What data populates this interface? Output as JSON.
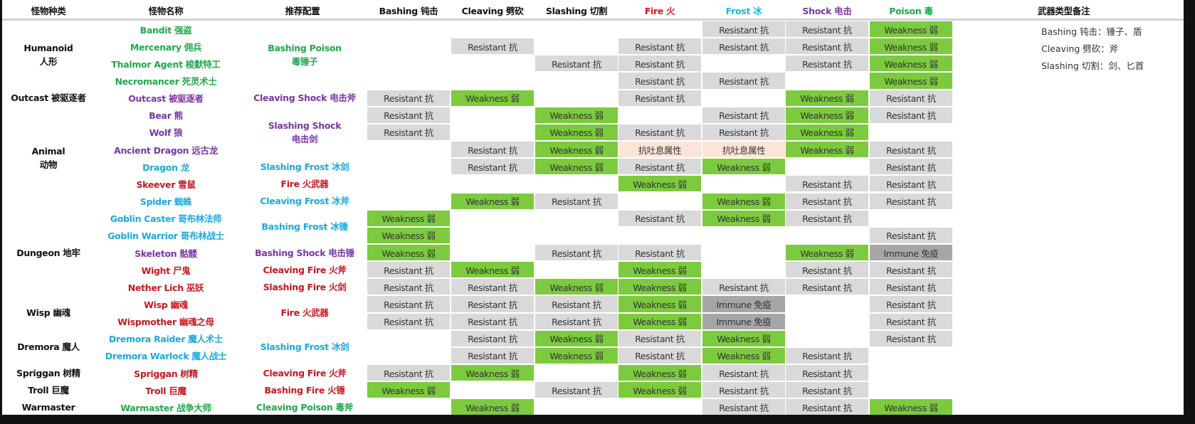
{
  "headers": {
    "type": "怪物种类",
    "name": "怪物名称",
    "config": "推荐配置",
    "damage": [
      {
        "label": "Bashing 钝击",
        "color": "#111111"
      },
      {
        "label": "Cleaving 劈砍",
        "color": "#111111"
      },
      {
        "label": "Slashing 切割",
        "color": "#111111"
      },
      {
        "label": "Fire 火",
        "color": "#e0141e"
      },
      {
        "label": "Frost 冰",
        "color": "#1eb4e6"
      },
      {
        "label": "Shock 电击",
        "color": "#7a35a8"
      },
      {
        "label": "Poison 毒",
        "color": "#1aab4b"
      }
    ],
    "notes": "武器类型备注"
  },
  "notes": [
    "Bashing 钝击：锤子、盾",
    "Cleaving 劈砍：斧",
    "Slashing 切割：剑、匕首"
  ],
  "colors": {
    "green": "#1fa84c",
    "purple": "#7a35a8",
    "cyan": "#1aa9e0",
    "red": "#c8161e"
  },
  "cell_colors": {
    "Resistant 抗": "#d9d9d9",
    "Weakness 弱": "#7ccb3e",
    "Immune 免疫": "#a6a6a6",
    "抗吐息属性": "#fce4d6"
  },
  "groups": [
    {
      "lines": [
        "Humanoid",
        "人形"
      ],
      "start": 0,
      "span": 4
    },
    {
      "lines": [
        "Outcast 被驱逐者"
      ],
      "start": 4,
      "span": 1
    },
    {
      "lines": [
        "Animal",
        "动物"
      ],
      "start": 5,
      "span": 6
    },
    {
      "lines": [
        "Dungeon 地牢"
      ],
      "start": 11,
      "span": 5
    },
    {
      "lines": [
        "Wisp 幽魂"
      ],
      "start": 16,
      "span": 2
    },
    {
      "lines": [
        "Dremora 魔人"
      ],
      "start": 18,
      "span": 2
    },
    {
      "lines": [
        "Spriggan 树精"
      ],
      "start": 20,
      "span": 1
    },
    {
      "lines": [
        "Troll 巨魔"
      ],
      "start": 21,
      "span": 1
    },
    {
      "lines": [
        "Warmaster"
      ],
      "start": 22,
      "span": 1
    }
  ],
  "configs": [
    {
      "lines": [
        "Bashing Poison",
        "毒锤子"
      ],
      "color": "green",
      "start": 0,
      "span": 4
    },
    {
      "lines": [
        "Cleaving Shock 电击斧"
      ],
      "color": "purple",
      "start": 4,
      "span": 1
    },
    {
      "lines": [
        "Slashing Shock",
        "电击剑"
      ],
      "color": "purple",
      "start": 5,
      "span": 3
    },
    {
      "lines": [
        "Slashing Frost 冰剑"
      ],
      "color": "cyan",
      "start": 8,
      "span": 1
    },
    {
      "lines": [
        "Fire 火武器"
      ],
      "color": "red",
      "start": 9,
      "span": 1
    },
    {
      "lines": [
        "Cleaving Frost 冰斧"
      ],
      "color": "cyan",
      "start": 10,
      "span": 1
    },
    {
      "lines": [
        "Bashing Frost 冰锤"
      ],
      "color": "cyan",
      "start": 11,
      "span": 2
    },
    {
      "lines": [
        "Bashing Shock 电击锤"
      ],
      "color": "purple",
      "start": 13,
      "span": 1
    },
    {
      "lines": [
        "Cleaving Fire 火斧"
      ],
      "color": "red",
      "start": 14,
      "span": 1
    },
    {
      "lines": [
        "Slashing Fire 火剑"
      ],
      "color": "red",
      "start": 15,
      "span": 1
    },
    {
      "lines": [
        "Fire 火武器"
      ],
      "color": "red",
      "start": 16,
      "span": 2
    },
    {
      "lines": [
        "Slashing Frost 冰剑"
      ],
      "color": "cyan",
      "start": 18,
      "span": 2
    },
    {
      "lines": [
        "Cleaving Fire 火斧"
      ],
      "color": "red",
      "start": 20,
      "span": 1
    },
    {
      "lines": [
        "Bashing Fire 火锤"
      ],
      "color": "red",
      "start": 21,
      "span": 1
    },
    {
      "lines": [
        "Cleaving Poison 毒斧"
      ],
      "color": "green",
      "start": 22,
      "span": 1
    }
  ],
  "rows": [
    {
      "name": "Bandit 强盗",
      "color": "green",
      "cells": [
        "",
        "",
        "",
        "",
        "Resistant 抗",
        "Resistant 抗",
        "Weakness 弱"
      ]
    },
    {
      "name": "Mercenary 佣兵",
      "color": "green",
      "cells": [
        "",
        "Resistant 抗",
        "",
        "Resistant 抗",
        "Resistant 抗",
        "Resistant 抗",
        "Weakness 弱"
      ]
    },
    {
      "name": "Thalmor Agent 梭默特工",
      "color": "green",
      "cells": [
        "",
        "",
        "Resistant 抗",
        "Resistant 抗",
        "",
        "Resistant 抗",
        "Weakness 弱"
      ]
    },
    {
      "name": "Necromancer 死灵术士",
      "color": "green",
      "cells": [
        "",
        "",
        "",
        "Resistant 抗",
        "Resistant 抗",
        "",
        "Weakness 弱"
      ]
    },
    {
      "name": "Outcast 被驱逐者",
      "color": "purple",
      "cells": [
        "Resistant 抗",
        "Weakness 弱",
        "",
        "Resistant 抗",
        "",
        "Weakness 弱",
        "Resistant 抗"
      ]
    },
    {
      "name": "Bear 熊",
      "color": "purple",
      "cells": [
        "Resistant 抗",
        "",
        "Weakness 弱",
        "",
        "Resistant 抗",
        "Weakness 弱",
        "Resistant 抗"
      ]
    },
    {
      "name": "Wolf 狼",
      "color": "purple",
      "cells": [
        "Resistant 抗",
        "",
        "Weakness 弱",
        "Resistant 抗",
        "Resistant 抗",
        "Weakness 弱",
        ""
      ]
    },
    {
      "name": "Ancient Dragon 远古龙",
      "color": "purple",
      "cells": [
        "",
        "Resistant 抗",
        "Weakness 弱",
        "抗吐息属性",
        "抗吐息属性",
        "Weakness 弱",
        "Resistant 抗"
      ]
    },
    {
      "name": "Dragon 龙",
      "color": "cyan",
      "cells": [
        "",
        "Resistant 抗",
        "Weakness 弱",
        "Resistant 抗",
        "Weakness 弱",
        "",
        "Resistant 抗"
      ]
    },
    {
      "name": "Skeever 雪鼠",
      "color": "red",
      "cells": [
        "",
        "",
        "",
        "Weakness 弱",
        "",
        "Resistant 抗",
        "Resistant 抗"
      ]
    },
    {
      "name": "Spider 蜘蛛",
      "color": "cyan",
      "cells": [
        "",
        "Weakness 弱",
        "Resistant 抗",
        "",
        "Weakness 弱",
        "Resistant 抗",
        "Resistant 抗"
      ]
    },
    {
      "name": "Goblin Caster 哥布林法师",
      "color": "cyan",
      "cells": [
        "Weakness 弱",
        "",
        "",
        "Resistant 抗",
        "Weakness 弱",
        "Resistant 抗",
        ""
      ]
    },
    {
      "name": "Goblin Warrior 哥布林战士",
      "color": "cyan",
      "cells": [
        "Weakness 弱",
        "",
        "",
        "",
        "",
        "",
        "Resistant 抗"
      ]
    },
    {
      "name": "Skeleton 骷髅",
      "color": "purple",
      "cells": [
        "Weakness 弱",
        "",
        "Resistant 抗",
        "Resistant 抗",
        "",
        "Weakness 弱",
        "Immune 免疫"
      ]
    },
    {
      "name": "Wight 尸鬼",
      "color": "red",
      "cells": [
        "Resistant 抗",
        "Weakness 弱",
        "",
        "Weakness 弱",
        "",
        "Resistant 抗",
        "Resistant 抗"
      ]
    },
    {
      "name": "Nether Lich 巫妖",
      "color": "red",
      "cells": [
        "Resistant 抗",
        "Resistant 抗",
        "Weakness 弱",
        "Weakness 弱",
        "Resistant 抗",
        "Resistant 抗",
        "Resistant 抗"
      ]
    },
    {
      "name": "Wisp 幽魂",
      "color": "red",
      "cells": [
        "Resistant 抗",
        "Resistant 抗",
        "Resistant 抗",
        "Weakness 弱",
        "Immune 免疫",
        "",
        "Resistant 抗"
      ]
    },
    {
      "name": "Wispmother 幽魂之母",
      "color": "red",
      "cells": [
        "Resistant 抗",
        "Resistant 抗",
        "Resistant 抗",
        "Weakness 弱",
        "Immune 免疫",
        "",
        "Resistant 抗"
      ]
    },
    {
      "name": "Dremora Raider 魔人术士",
      "color": "cyan",
      "cells": [
        "",
        "Resistant 抗",
        "Weakness 弱",
        "Resistant 抗",
        "Weakness 弱",
        "",
        "Resistant 抗"
      ]
    },
    {
      "name": "Dremora Warlock 魔人战士",
      "color": "cyan",
      "cells": [
        "",
        "Resistant 抗",
        "Weakness 弱",
        "Resistant 抗",
        "Weakness 弱",
        "Resistant 抗",
        ""
      ]
    },
    {
      "name": "Spriggan 树精",
      "color": "red",
      "cells": [
        "Resistant 抗",
        "Weakness 弱",
        "",
        "Weakness 弱",
        "Resistant 抗",
        "Resistant 抗",
        ""
      ]
    },
    {
      "name": "Troll 巨魔",
      "color": "red",
      "cells": [
        "Weakness 弱",
        "",
        "Resistant 抗",
        "Weakness 弱",
        "Resistant 抗",
        "Resistant 抗",
        ""
      ]
    },
    {
      "name": "Warmaster 战争大师",
      "color": "green",
      "cells": [
        "",
        "Weakness 弱",
        "",
        "",
        "Resistant 抗",
        "Resistant 抗",
        "Weakness 弱"
      ]
    }
  ]
}
